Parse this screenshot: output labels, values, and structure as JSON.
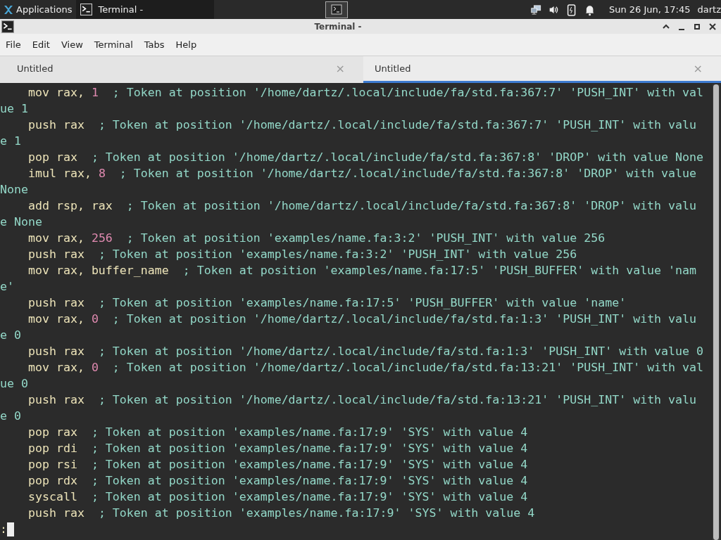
{
  "panel": {
    "apps_label": "Applications",
    "task": {
      "label": "Terminal -",
      "selected": true
    },
    "clock": "Sun 26 Jun, 17:45",
    "user": "dartz"
  },
  "window": {
    "title": "Terminal -"
  },
  "menu": [
    "File",
    "Edit",
    "View",
    "Terminal",
    "Tabs",
    "Help"
  ],
  "tabs": [
    {
      "label": "Untitled",
      "close": "×",
      "selected": false
    },
    {
      "label": "Untitled",
      "close": "×",
      "selected": true
    }
  ],
  "lines": [
    [
      {
        "kind": "code",
        "text": "    mov rax, "
      },
      {
        "kind": "number",
        "text": "1"
      },
      {
        "kind": "comment",
        "text": "  ; Token at position '/home/dartz/.local/include/fa/std.fa:367:7' 'PUSH_INT' with value 1"
      }
    ],
    [
      {
        "kind": "code",
        "text": "    push rax"
      },
      {
        "kind": "comment",
        "text": "  ; Token at position '/home/dartz/.local/include/fa/std.fa:367:7' 'PUSH_INT' with value 1"
      }
    ],
    [
      {
        "kind": "code",
        "text": "    pop rax"
      },
      {
        "kind": "comment",
        "text": "  ; Token at position '/home/dartz/.local/include/fa/std.fa:367:8' 'DROP' with value None"
      }
    ],
    [
      {
        "kind": "code",
        "text": "    imul rax, "
      },
      {
        "kind": "number",
        "text": "8"
      },
      {
        "kind": "comment",
        "text": "  ; Token at position '/home/dartz/.local/include/fa/std.fa:367:8' 'DROP' with value None"
      }
    ],
    [
      {
        "kind": "code",
        "text": "    add rsp, rax"
      },
      {
        "kind": "comment",
        "text": "  ; Token at position '/home/dartz/.local/include/fa/std.fa:367:8' 'DROP' with value None"
      }
    ],
    [
      {
        "kind": "code",
        "text": "    mov rax, "
      },
      {
        "kind": "number",
        "text": "256"
      },
      {
        "kind": "comment",
        "text": "  ; Token at position 'examples/name.fa:3:2' 'PUSH_INT' with value 256"
      }
    ],
    [
      {
        "kind": "code",
        "text": "    push rax"
      },
      {
        "kind": "comment",
        "text": "  ; Token at position 'examples/name.fa:3:2' 'PUSH_INT' with value 256"
      }
    ],
    [
      {
        "kind": "code",
        "text": "    mov rax, buffer_name"
      },
      {
        "kind": "comment",
        "text": "  ; Token at position 'examples/name.fa:17:5' 'PUSH_BUFFER' with value 'name'"
      }
    ],
    [
      {
        "kind": "code",
        "text": "    push rax"
      },
      {
        "kind": "comment",
        "text": "  ; Token at position 'examples/name.fa:17:5' 'PUSH_BUFFER' with value 'name'"
      }
    ],
    [
      {
        "kind": "code",
        "text": "    mov rax, "
      },
      {
        "kind": "number",
        "text": "0"
      },
      {
        "kind": "comment",
        "text": "  ; Token at position '/home/dartz/.local/include/fa/std.fa:1:3' 'PUSH_INT' with value 0"
      }
    ],
    [
      {
        "kind": "code",
        "text": "    push rax"
      },
      {
        "kind": "comment",
        "text": "  ; Token at position '/home/dartz/.local/include/fa/std.fa:1:3' 'PUSH_INT' with value 0"
      }
    ],
    [
      {
        "kind": "code",
        "text": "    mov rax, "
      },
      {
        "kind": "number",
        "text": "0"
      },
      {
        "kind": "comment",
        "text": "  ; Token at position '/home/dartz/.local/include/fa/std.fa:13:21' 'PUSH_INT' with value 0"
      }
    ],
    [
      {
        "kind": "code",
        "text": "    push rax"
      },
      {
        "kind": "comment",
        "text": "  ; Token at position '/home/dartz/.local/include/fa/std.fa:13:21' 'PUSH_INT' with value 0"
      }
    ],
    [
      {
        "kind": "code",
        "text": "    pop rax"
      },
      {
        "kind": "comment",
        "text": "  ; Token at position 'examples/name.fa:17:9' 'SYS' with value 4"
      }
    ],
    [
      {
        "kind": "code",
        "text": "    pop rdi"
      },
      {
        "kind": "comment",
        "text": "  ; Token at position 'examples/name.fa:17:9' 'SYS' with value 4"
      }
    ],
    [
      {
        "kind": "code",
        "text": "    pop rsi"
      },
      {
        "kind": "comment",
        "text": "  ; Token at position 'examples/name.fa:17:9' 'SYS' with value 4"
      }
    ],
    [
      {
        "kind": "code",
        "text": "    pop rdx"
      },
      {
        "kind": "comment",
        "text": "  ; Token at position 'examples/name.fa:17:9' 'SYS' with value 4"
      }
    ],
    [
      {
        "kind": "code",
        "text": "    syscall"
      },
      {
        "kind": "comment",
        "text": "  ; Token at position 'examples/name.fa:17:9' 'SYS' with value 4"
      }
    ],
    [
      {
        "kind": "code",
        "text": "    push rax"
      },
      {
        "kind": "comment",
        "text": "  ; Token at position 'examples/name.fa:17:9' 'SYS' with value 4"
      }
    ]
  ],
  "prompt": ":"
}
